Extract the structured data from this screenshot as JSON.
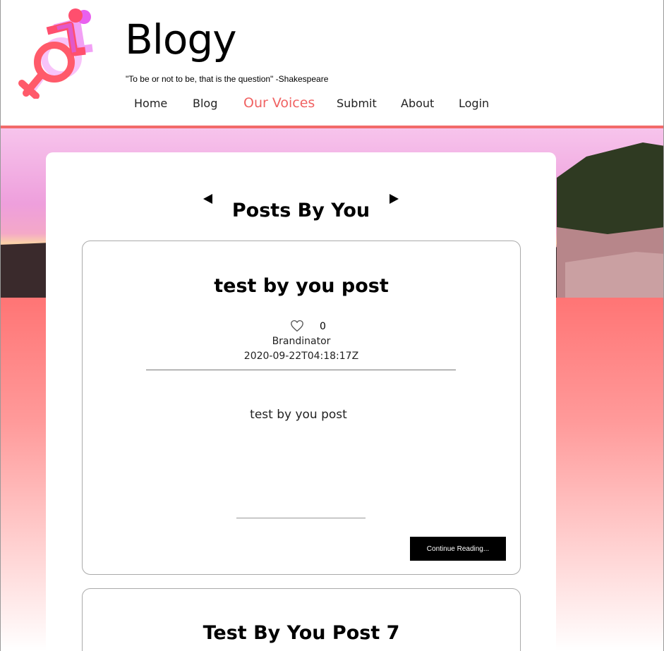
{
  "brand": {
    "title": "Blogy",
    "tagline": "\"To be or not to be, that is the question\" -Shakespeare",
    "logo_icon": "wheelchair-female-symbol-icon"
  },
  "nav": {
    "items": [
      {
        "label": "Home"
      },
      {
        "label": "Blog"
      },
      {
        "label": "Our Voices",
        "active": true
      },
      {
        "label": "Submit"
      },
      {
        "label": "About"
      },
      {
        "label": "Login"
      }
    ]
  },
  "colors": {
    "accent": "#f06262",
    "hero_gradient_top": "#ff6060",
    "button_bg": "#000000"
  },
  "section": {
    "title": "Posts By You",
    "prev_icon": "triangle-left-icon",
    "next_icon": "triangle-right-icon"
  },
  "posts": [
    {
      "title": "test by you post",
      "likes": "0",
      "author": "Brandinator",
      "date": "2020-09-22T04:18:17Z",
      "excerpt": "test by you post",
      "cta": "Continue Reading..."
    },
    {
      "title": "Test By You Post 7"
    }
  ]
}
